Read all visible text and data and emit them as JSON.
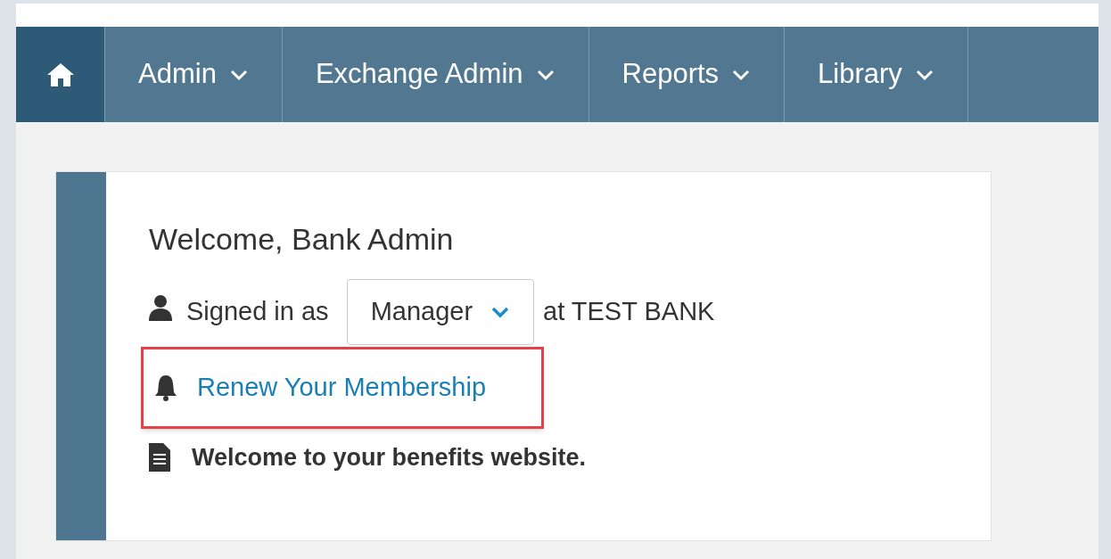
{
  "nav": {
    "items": [
      {
        "label": "Admin"
      },
      {
        "label": "Exchange Admin"
      },
      {
        "label": "Reports"
      },
      {
        "label": "Library"
      }
    ]
  },
  "welcome": {
    "title": "Welcome, Bank Admin",
    "signed_in_label": "Signed in as",
    "role_select": {
      "value": "Manager"
    },
    "org_text": "at TEST BANK",
    "renew_link": {
      "label": "Renew Your Membership",
      "highlighted": true
    },
    "message": "Welcome to your benefits website."
  }
}
